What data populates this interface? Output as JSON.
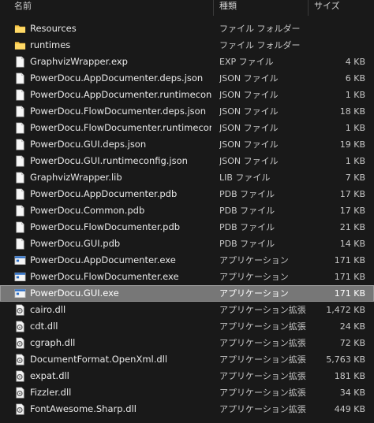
{
  "columns": {
    "name": "名前",
    "type": "種類",
    "size": "サイズ"
  },
  "files": [
    {
      "name": "Resources",
      "type": "ファイル フォルダー",
      "size": "",
      "icon": "folder-icon"
    },
    {
      "name": "runtimes",
      "type": "ファイル フォルダー",
      "size": "",
      "icon": "folder-icon"
    },
    {
      "name": "GraphvizWrapper.exp",
      "type": "EXP ファイル",
      "size": "4 KB",
      "icon": "document-icon"
    },
    {
      "name": "PowerDocu.AppDocumenter.deps.json",
      "type": "JSON ファイル",
      "size": "6 KB",
      "icon": "document-icon"
    },
    {
      "name": "PowerDocu.AppDocumenter.runtimecon...",
      "type": "JSON ファイル",
      "size": "1 KB",
      "icon": "document-icon"
    },
    {
      "name": "PowerDocu.FlowDocumenter.deps.json",
      "type": "JSON ファイル",
      "size": "18 KB",
      "icon": "document-icon"
    },
    {
      "name": "PowerDocu.FlowDocumenter.runtimecon...",
      "type": "JSON ファイル",
      "size": "1 KB",
      "icon": "document-icon"
    },
    {
      "name": "PowerDocu.GUI.deps.json",
      "type": "JSON ファイル",
      "size": "19 KB",
      "icon": "document-icon"
    },
    {
      "name": "PowerDocu.GUI.runtimeconfig.json",
      "type": "JSON ファイル",
      "size": "1 KB",
      "icon": "document-icon"
    },
    {
      "name": "GraphvizWrapper.lib",
      "type": "LIB ファイル",
      "size": "7 KB",
      "icon": "document-icon"
    },
    {
      "name": "PowerDocu.AppDocumenter.pdb",
      "type": "PDB ファイル",
      "size": "17 KB",
      "icon": "document-icon"
    },
    {
      "name": "PowerDocu.Common.pdb",
      "type": "PDB ファイル",
      "size": "17 KB",
      "icon": "document-icon"
    },
    {
      "name": "PowerDocu.FlowDocumenter.pdb",
      "type": "PDB ファイル",
      "size": "21 KB",
      "icon": "document-icon"
    },
    {
      "name": "PowerDocu.GUI.pdb",
      "type": "PDB ファイル",
      "size": "14 KB",
      "icon": "document-icon"
    },
    {
      "name": "PowerDocu.AppDocumenter.exe",
      "type": "アプリケーション",
      "size": "171 KB",
      "icon": "application-icon"
    },
    {
      "name": "PowerDocu.FlowDocumenter.exe",
      "type": "アプリケーション",
      "size": "171 KB",
      "icon": "application-icon"
    },
    {
      "name": "PowerDocu.GUI.exe",
      "type": "アプリケーション",
      "size": "171 KB",
      "icon": "application-icon",
      "selected": true
    },
    {
      "name": "cairo.dll",
      "type": "アプリケーション拡張",
      "size": "1,472 KB",
      "icon": "dll-gear-icon"
    },
    {
      "name": "cdt.dll",
      "type": "アプリケーション拡張",
      "size": "24 KB",
      "icon": "dll-gear-icon"
    },
    {
      "name": "cgraph.dll",
      "type": "アプリケーション拡張",
      "size": "72 KB",
      "icon": "dll-gear-icon"
    },
    {
      "name": "DocumentFormat.OpenXml.dll",
      "type": "アプリケーション拡張",
      "size": "5,763 KB",
      "icon": "dll-gear-icon"
    },
    {
      "name": "expat.dll",
      "type": "アプリケーション拡張",
      "size": "181 KB",
      "icon": "dll-gear-icon"
    },
    {
      "name": "Fizzler.dll",
      "type": "アプリケーション拡張",
      "size": "34 KB",
      "icon": "dll-gear-icon"
    },
    {
      "name": "FontAwesome.Sharp.dll",
      "type": "アプリケーション拡張",
      "size": "449 KB",
      "icon": "dll-gear-icon"
    }
  ]
}
